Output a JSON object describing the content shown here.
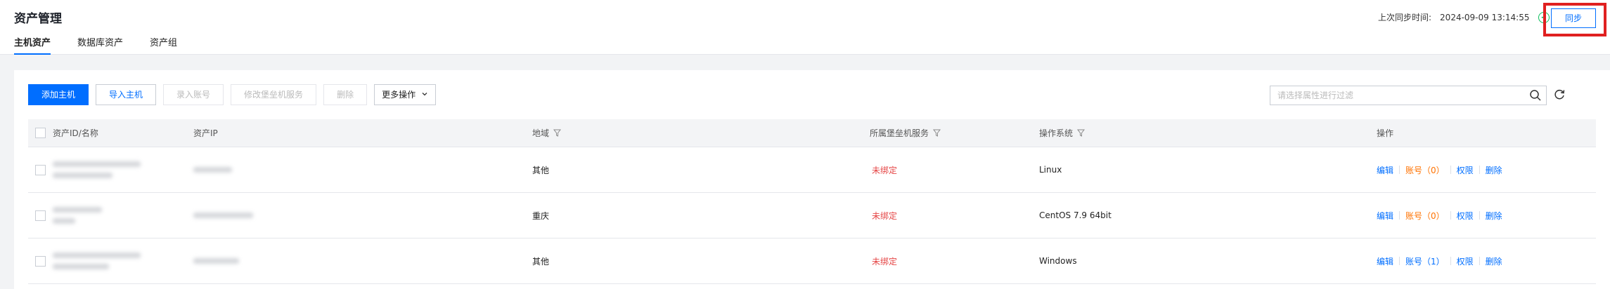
{
  "header": {
    "title": "资产管理",
    "tabs": [
      {
        "label": "主机资产",
        "active": true
      },
      {
        "label": "数据库资产",
        "active": false
      },
      {
        "label": "资产组",
        "active": false
      }
    ],
    "sync_label": "上次同步时间:",
    "sync_time": "2024-09-09 13:14:55",
    "sync_button": "同步"
  },
  "toolbar": {
    "add_host": "添加主机",
    "import_host": "导入主机",
    "enter_account": "录入账号",
    "modify_bastion": "修改堡垒机服务",
    "delete": "删除",
    "more_actions": "更多操作"
  },
  "search": {
    "placeholder": "请选择属性进行过滤"
  },
  "table": {
    "columns": {
      "id_name": "资产ID/名称",
      "ip": "资产IP",
      "region": "地域",
      "bastion": "所属堡垒机服务",
      "os": "操作系统",
      "actions": "操作"
    },
    "rows": [
      {
        "region": "其他",
        "bastion": "未绑定",
        "os": "Linux",
        "edit": "编辑",
        "account": "账号（0）",
        "perm": "权限",
        "delete": "删除",
        "account_warn": true
      },
      {
        "region": "重庆",
        "bastion": "未绑定",
        "os": "CentOS 7.9 64bit",
        "edit": "编辑",
        "account": "账号（0）",
        "perm": "权限",
        "delete": "删除",
        "account_warn": true
      },
      {
        "region": "其他",
        "bastion": "未绑定",
        "os": "Windows",
        "edit": "编辑",
        "account": "账号（1）",
        "perm": "权限",
        "delete": "删除",
        "account_warn": false
      }
    ]
  },
  "colors": {
    "primary": "#006eff",
    "danger": "#e54545",
    "warning": "#ff7200",
    "highlight": "#e02020",
    "success": "#0abf5b"
  }
}
